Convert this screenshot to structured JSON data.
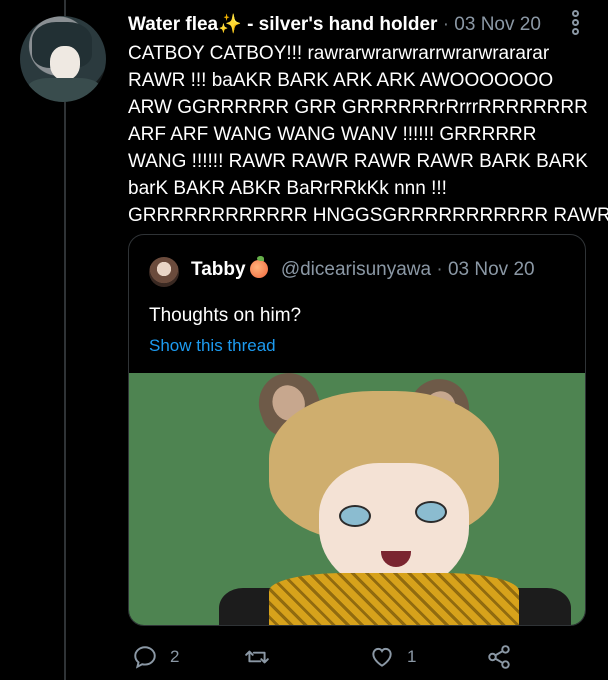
{
  "tweet": {
    "author_name": "Water flea",
    "name_emoji": "✨",
    "author_suffix": "- silver's hand holder",
    "separator": "·",
    "date": "03 Nov 20",
    "text_lines": [
      "CATBOY CATBOY!!! rawrarwrarwrarrwrarwrararar",
      "RAWR !!! baAKR BARK ARK ARK AWOOOOOOO",
      "ARW GGRRRRRR GRR GRRRRRRrRrrrRRRRRRRR",
      "ARF ARF WANG WANG WANV !!!!!! GRRRRRR",
      "WANG !!!!!! RAWR RAWR RAWR RAWR  BARK BARK",
      "barK BAKR ABKR BaRrRRkKk nnn !!!",
      "GRRRRRRRRRRRR HNGGSGRRRRRRRRRRR RAWR"
    ]
  },
  "quote": {
    "author_name": "Tabby",
    "name_emoji": "peach",
    "handle": "@dicearisunyawa",
    "separator": "·",
    "date": "03 Nov 20",
    "text": "Thoughts on him?",
    "show_thread": "Show this thread"
  },
  "actions": {
    "reply_count": "2",
    "retweet_count": "",
    "like_count": "1"
  },
  "colors": {
    "background": "#000000",
    "accent_link": "#1d9bf0",
    "muted": "#8b98a5",
    "image_bg": "#4e8451"
  },
  "icons": [
    "more-vertical-icon",
    "reply-icon",
    "retweet-icon",
    "like-icon",
    "share-icon"
  ]
}
